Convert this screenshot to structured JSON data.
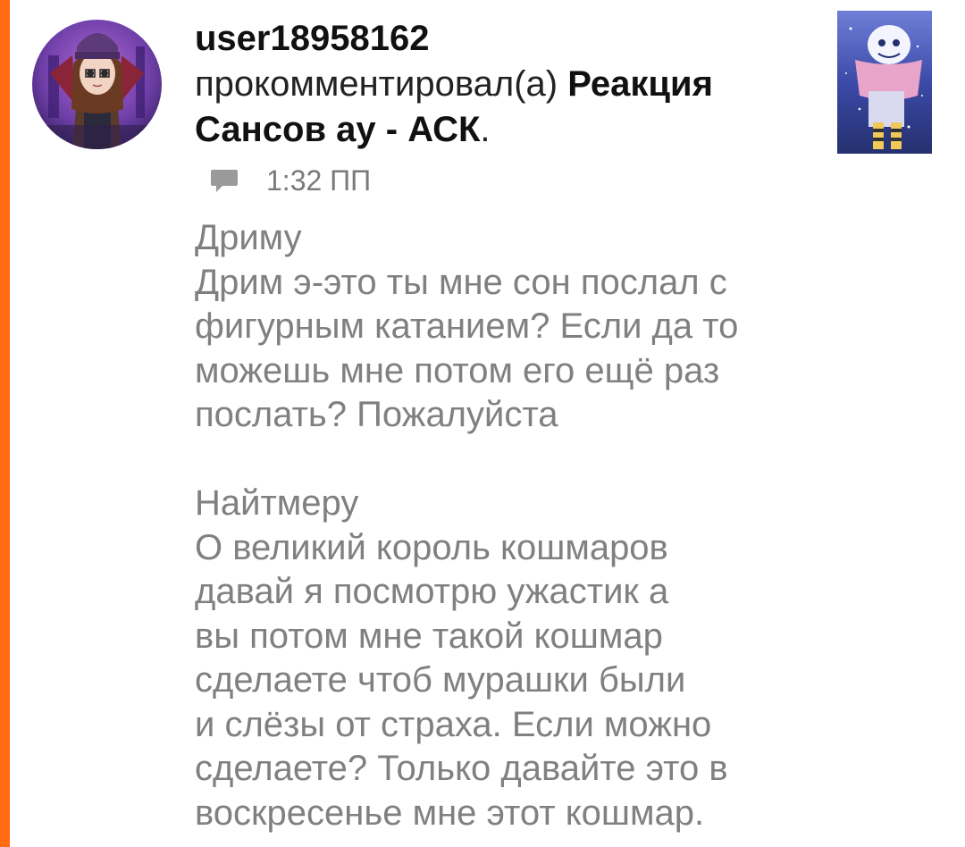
{
  "notification": {
    "username": "user18958162",
    "action_text": "прокомментировал(а) ",
    "post_title": "Реакция Сансов ау - АСК",
    "post_title_suffix": ".",
    "time": "1:32 ПП",
    "comment_lines": [
      "Дриму",
      "Дрим э-это ты мне сон послал с",
      "фигурным катанием? Если да то",
      "можешь мне потом его ещё раз",
      "послать? Пожалуйста",
      "",
      "Найтмеру",
      "О великий король кошмаров",
      "давай я посмотрю ужастик а",
      "вы потом мне такой кошмар",
      "сделаете чтоб мурашки были",
      "и слёзы от страха. Если можно",
      "сделаете? Только давайте это в",
      "воскресенье мне этот кошмар."
    ]
  },
  "icons": {
    "comment": "comment-bubble-icon",
    "avatar": "user-avatar-image",
    "thumbnail": "post-thumbnail-image"
  },
  "colors": {
    "accent": "#ff6a13",
    "text_primary": "#111111",
    "text_secondary": "#808080",
    "meta": "#7a7a7a"
  }
}
